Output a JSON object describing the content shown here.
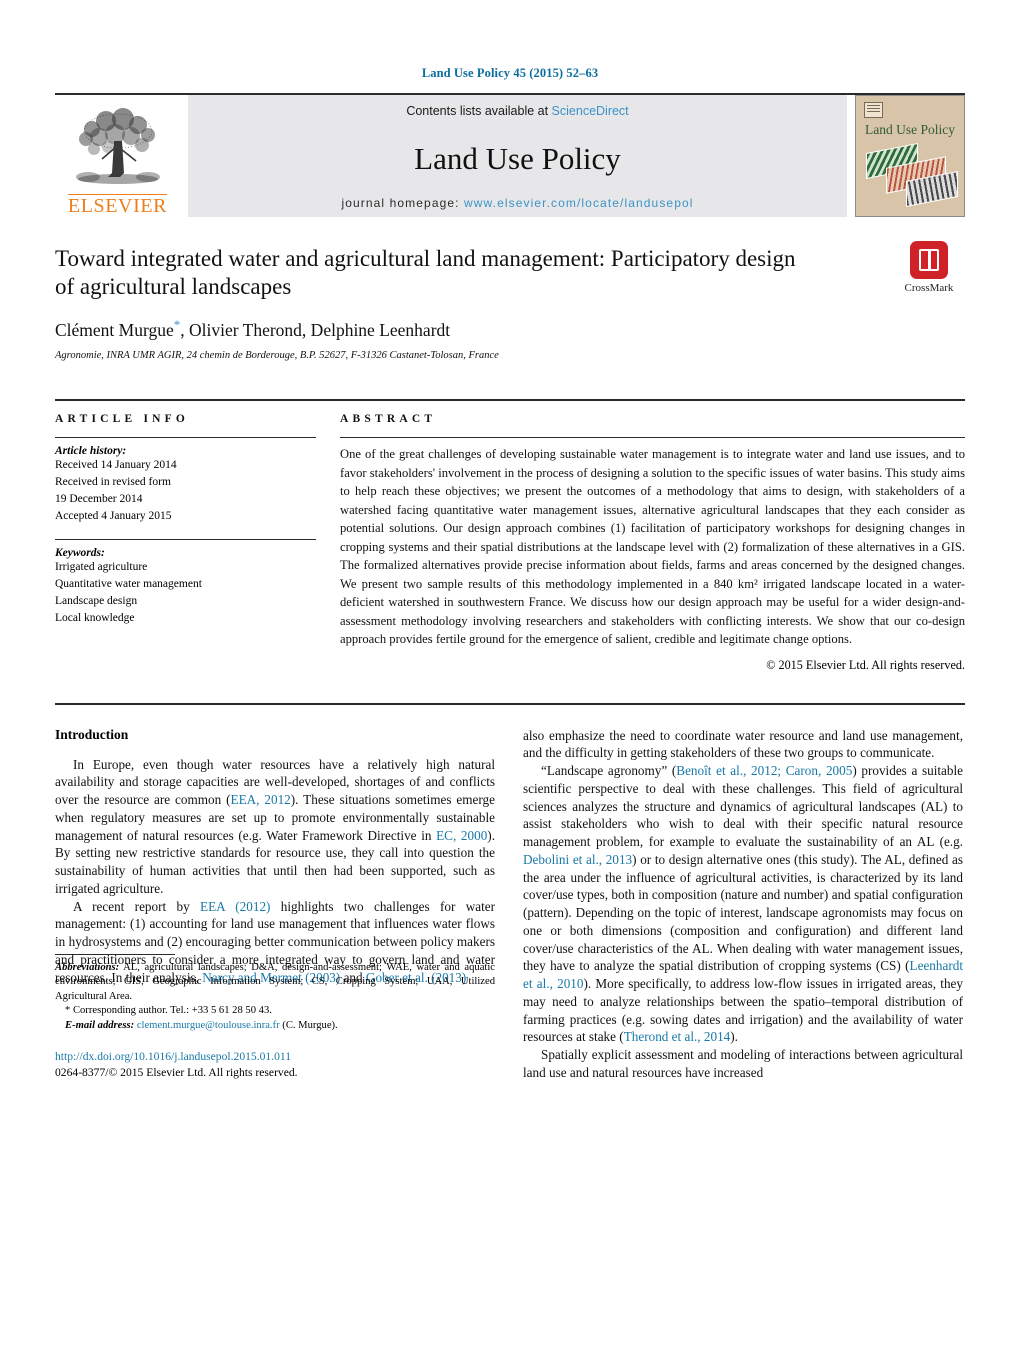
{
  "running_head": "Land Use Policy 45 (2015) 52–63",
  "masthead": {
    "publisher_name": "ELSEVIER",
    "contents_prefix": "Contents lists available at ",
    "sciencedirect": "ScienceDirect",
    "journal_title": "Land Use Policy",
    "homepage_label": "journal homepage: ",
    "homepage_url": "www.elsevier.com/locate/landusepol",
    "cover_title": "Land Use Policy"
  },
  "article": {
    "title": "Toward integrated water and agricultural land management: Participatory design of agricultural landscapes",
    "authors": "Clément Murgue",
    "authors_rest": ", Olivier Therond, Delphine Leenhardt",
    "corresponding_marker": "*",
    "affiliation": "Agronomie, INRA UMR AGIR, 24 chemin de Borderouge, B.P. 52627, F-31326 Castanet-Tolosan, France",
    "crossmark_label": "CrossMark"
  },
  "article_info": {
    "heading": "ARTICLE INFO",
    "history_label": "Article history:",
    "history": [
      "Received 14 January 2014",
      "Received in revised form",
      "19 December 2014",
      "Accepted 4 January 2015"
    ],
    "keywords_label": "Keywords:",
    "keywords": [
      "Irrigated agriculture",
      "Quantitative water management",
      "Landscape design",
      "Local knowledge"
    ]
  },
  "abstract": {
    "heading": "ABSTRACT",
    "text": "One of the great challenges of developing sustainable water management is to integrate water and land use issues, and to favor stakeholders' involvement in the process of designing a solution to the specific issues of water basins. This study aims to help reach these objectives; we present the outcomes of a methodology that aims to design, with stakeholders of a watershed facing quantitative water management issues, alternative agricultural landscapes that they each consider as potential solutions. Our design approach combines (1) facilitation of participatory workshops for designing changes in cropping systems and their spatial distributions at the landscape level with (2) formalization of these alternatives in a GIS. The formalized alternatives provide precise information about fields, farms and areas concerned by the designed changes. We present two sample results of this methodology implemented in a 840 km² irrigated landscape located in a water-deficient watershed in southwestern France. We discuss how our design approach may be useful for a wider design-and-assessment methodology involving researchers and stakeholders with conflicting interests. We show that our co-design approach provides fertile ground for the emergence of salient, credible and legitimate change options.",
    "copyright": "© 2015 Elsevier Ltd. All rights reserved."
  },
  "body": {
    "section_heading": "Introduction",
    "left_paragraphs": [
      {
        "parts": [
          {
            "t": "In Europe, even though water resources have a relatively high natural availability and storage capacities are well-developed, shortages of and conflicts over the resource are common ("
          },
          {
            "t": "EEA, 2012",
            "ref": true
          },
          {
            "t": "). These situations sometimes emerge when regulatory measures are set up to promote environmentally sustainable management of natural resources (e.g. Water Framework Directive in "
          },
          {
            "t": "EC, 2000",
            "ref": true
          },
          {
            "t": "). By setting new restrictive standards for resource use, they call into question the sustainability of human activities that until then had been supported, such as irrigated agriculture."
          }
        ]
      },
      {
        "parts": [
          {
            "t": "A recent report by "
          },
          {
            "t": "EEA (2012)",
            "ref": true
          },
          {
            "t": " highlights two challenges for water management: (1) accounting for land use management that influences water flows in hydrosystems and (2) encouraging better communication between policy makers and practitioners to consider a more integrated way to govern land and water resources. In their analysis, "
          },
          {
            "t": "Narcy and Mermet (2003)",
            "ref": true
          },
          {
            "t": " and "
          },
          {
            "t": "Gober et al. (2013)",
            "ref": true
          }
        ]
      }
    ],
    "right_paragraphs": [
      {
        "noindent": true,
        "parts": [
          {
            "t": "also emphasize the need to coordinate water resource and land use management, and the difficulty in getting stakeholders of these two groups to communicate."
          }
        ]
      },
      {
        "parts": [
          {
            "t": "“Landscape agronomy” ("
          },
          {
            "t": "Benoît et al., 2012; Caron, 2005",
            "ref": true
          },
          {
            "t": ") provides a suitable scientific perspective to deal with these challenges. This field of agricultural sciences analyzes the structure and dynamics of agricultural landscapes (AL) to assist stakeholders who wish to deal with their specific natural resource management problem, for example to evaluate the sustainability of an AL (e.g. "
          },
          {
            "t": "Debolini et al., 2013",
            "ref": true
          },
          {
            "t": ") or to design alternative ones (this study). The AL, defined as the area under the influence of agricultural activities, is characterized by its land cover/use types, both in composition (nature and number) and spatial configuration (pattern). Depending on the topic of interest, landscape agronomists may focus on one or both dimensions (composition and configuration) and different land cover/use characteristics of the AL. When dealing with water management issues, they have to analyze the spatial distribution of cropping systems (CS) ("
          },
          {
            "t": "Leenhardt et al., 2010",
            "ref": true
          },
          {
            "t": "). More specifically, to address low-flow issues in irrigated areas, they may need to analyze relationships between the spatio–temporal distribution of farming practices (e.g. sowing dates and irrigation) and the availability of water resources at stake ("
          },
          {
            "t": "Therond et al., 2014",
            "ref": true
          },
          {
            "t": ")."
          }
        ]
      },
      {
        "parts": [
          {
            "t": "Spatially explicit assessment and modeling of interactions between agricultural land use and natural resources have increased"
          }
        ]
      }
    ]
  },
  "footnotes": {
    "abbreviations_label": "Abbreviations:",
    "abbreviations_text": " AL, agricultural landscapes; D&A, design-and-assessment; WAE, water and aquatic environments; GIS, Geographic Information System; CS, Cropping System; UAA, Utilized Agricultural Area.",
    "corresponding": "* Corresponding author. Tel.: +33 5 61 28 50 43.",
    "email_label": "E-mail address:",
    "email": "clement.murgue@toulouse.inra.fr",
    "email_suffix": " (C. Murgue).",
    "doi": "http://dx.doi.org/10.1016/j.landusepol.2015.01.011",
    "issn": "0264-8377/© 2015 Elsevier Ltd. All rights reserved."
  },
  "colors": {
    "link_blue": "#1878a8",
    "sciencedirect_blue": "#3b93c7",
    "elsevier_orange": "#ef7d1a",
    "crossmark_red": "#cf2127",
    "banner_gray": "#e7e7e9"
  }
}
